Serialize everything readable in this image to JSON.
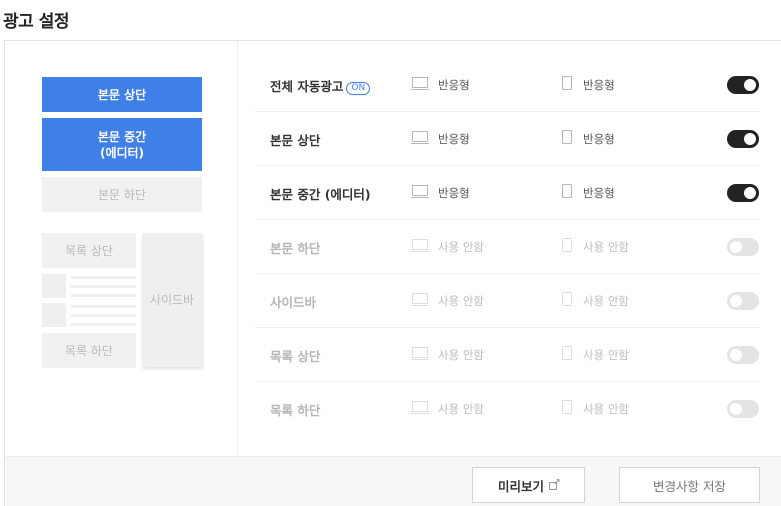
{
  "page": {
    "title": "광고 설정"
  },
  "preview": {
    "top": "본문 상단",
    "middle_line1": "본문 중간",
    "middle_line2": "(에디터)",
    "bottom": "본문 하단",
    "list_top": "목록 상단",
    "list_bottom": "목록 하단",
    "sidebar": "사이드바"
  },
  "rows": [
    {
      "label": "전체 자동광고",
      "badge": "ON",
      "pc": "반응형",
      "mobile": "반응형",
      "enabled": true
    },
    {
      "label": "본문 상단",
      "pc": "반응형",
      "mobile": "반응형",
      "enabled": true
    },
    {
      "label": "본문 중간 (에디터)",
      "pc": "반응형",
      "mobile": "반응형",
      "enabled": true
    },
    {
      "label": "본문 하단",
      "pc": "사용 안함",
      "mobile": "사용 안함",
      "enabled": false
    },
    {
      "label": "사이드바",
      "pc": "사용 안함",
      "mobile": "사용 안함",
      "enabled": false
    },
    {
      "label": "목록 상단",
      "pc": "사용 안함",
      "mobile": "사용 안함",
      "enabled": false
    },
    {
      "label": "목록 하단",
      "pc": "사용 안함",
      "mobile": "사용 안함",
      "enabled": false
    }
  ],
  "icons": {
    "pc": "desktop-monitor-icon",
    "mobile": "mobile-phone-icon",
    "external": "external-link-icon"
  },
  "footer": {
    "preview_label": "미리보기",
    "save_label": "변경사항 저장"
  },
  "colors": {
    "accent": "#3f7fe8",
    "toggle_on": "#222222",
    "toggle_off": "#e4e4e4"
  }
}
